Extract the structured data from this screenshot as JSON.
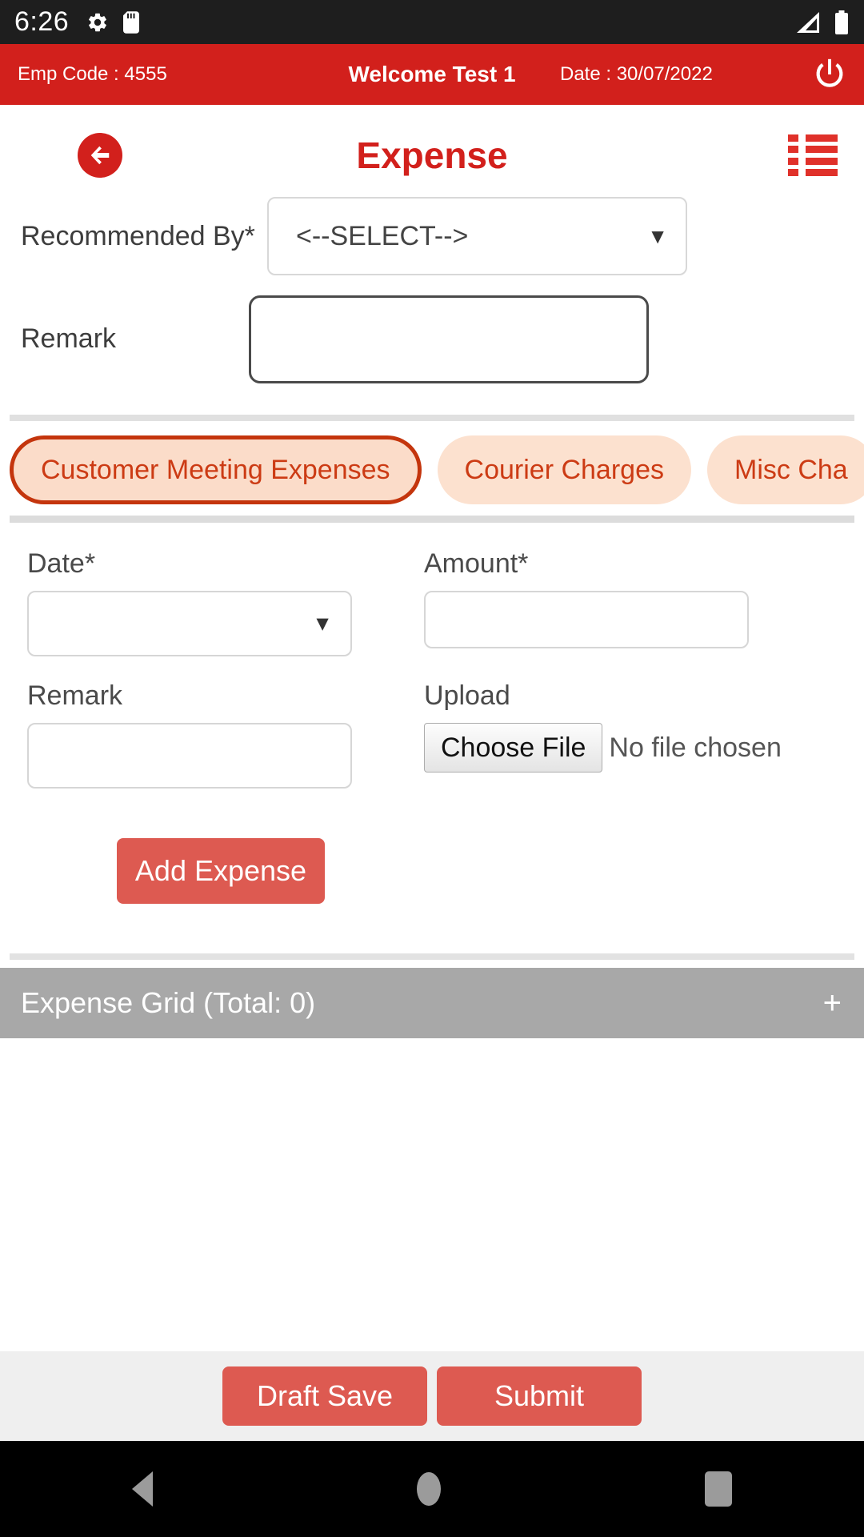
{
  "status_bar": {
    "time": "6:26",
    "icons": [
      "gear-icon",
      "sd-card-icon",
      "signal-icon",
      "battery-icon"
    ]
  },
  "emp_bar": {
    "emp_code": "Emp Code : 4555",
    "welcome": "Welcome Test 1",
    "date": "Date : 30/07/2022",
    "power_icon": "power-icon",
    "background": "#d2201c"
  },
  "title_bar": {
    "back_icon": "back-arrow-icon",
    "title": "Expense",
    "menu_icon": "list-menu-icon",
    "accent": "#d2201c"
  },
  "top_form": {
    "recommended_by": {
      "label": "Recommended By*",
      "value": "<--SELECT-->",
      "caret": "▼"
    },
    "remark": {
      "label": "Remark",
      "value": "",
      "placeholder": ""
    }
  },
  "category_tabs": {
    "selected_index": 0,
    "items": [
      {
        "label": "Customer Meeting Expenses",
        "selected": true
      },
      {
        "label": "Courier Charges",
        "selected": false
      },
      {
        "label": "Misc Cha",
        "selected": false
      }
    ],
    "chip_bg": "#fce1cf",
    "chip_text": "#cc3b14",
    "chip_active_border": "#c4350d"
  },
  "detail_form": {
    "date": {
      "label": "Date*",
      "value": "",
      "caret": "▼"
    },
    "amount": {
      "label": "Amount*",
      "value": "",
      "placeholder": ""
    },
    "remark": {
      "label": "Remark",
      "value": "",
      "placeholder": ""
    },
    "upload": {
      "label": "Upload",
      "button_label": "Choose File",
      "file_status": "No file chosen"
    },
    "add_expense_label": "Add Expense"
  },
  "expense_grid": {
    "title": "Expense Grid (Total: 0)",
    "add_icon": "+",
    "background": "#a8a8a8"
  },
  "footer": {
    "draft_save_label": "Draft Save",
    "submit_label": "Submit",
    "button_color": "#dd5a51"
  },
  "nav_bar": {
    "back": "nav-back-icon",
    "home": "nav-home-icon",
    "recents": "nav-recents-icon"
  }
}
